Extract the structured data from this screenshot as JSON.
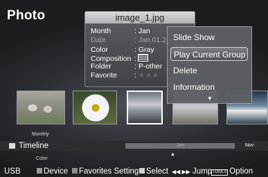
{
  "page": {
    "title": "Photo"
  },
  "info_popup": {
    "filename": "image_1.jpg",
    "rows": [
      {
        "label": "Month",
        "value": ": Jan"
      },
      {
        "label": "Date",
        "value": ": Jan.01.2"
      },
      {
        "label": "Color",
        "value": ": Gray"
      },
      {
        "label": "Composition",
        "value": ":"
      },
      {
        "label": "Folder",
        "value": ": P-other"
      },
      {
        "label": "Favorite",
        "value": ":"
      }
    ],
    "favorite_stars": "★★★",
    "composition_icon": "horizontal-lines-icon"
  },
  "menu": {
    "items": [
      "Slide Show",
      "Play Current Group",
      "Delete",
      "Information"
    ],
    "selected_index": 1,
    "more_indicator": "▼"
  },
  "timeline": {
    "above_label": "Monthly",
    "label": "Timeline",
    "below_label": "Color",
    "months": [
      "Jan",
      "Nov"
    ],
    "pointer": "▲"
  },
  "bottom_bar": {
    "source": "USB",
    "device": "Device",
    "favorites": "Favorites Setting",
    "select": "Select",
    "jump_arrows": "◀◀ ▶▶",
    "jump": "Jump",
    "tools": "TOOLS",
    "option": "Option",
    "colors": {
      "device": "#9a9a9a",
      "favorites": "#8c8c8c",
      "select": "#d0d0d0"
    }
  }
}
